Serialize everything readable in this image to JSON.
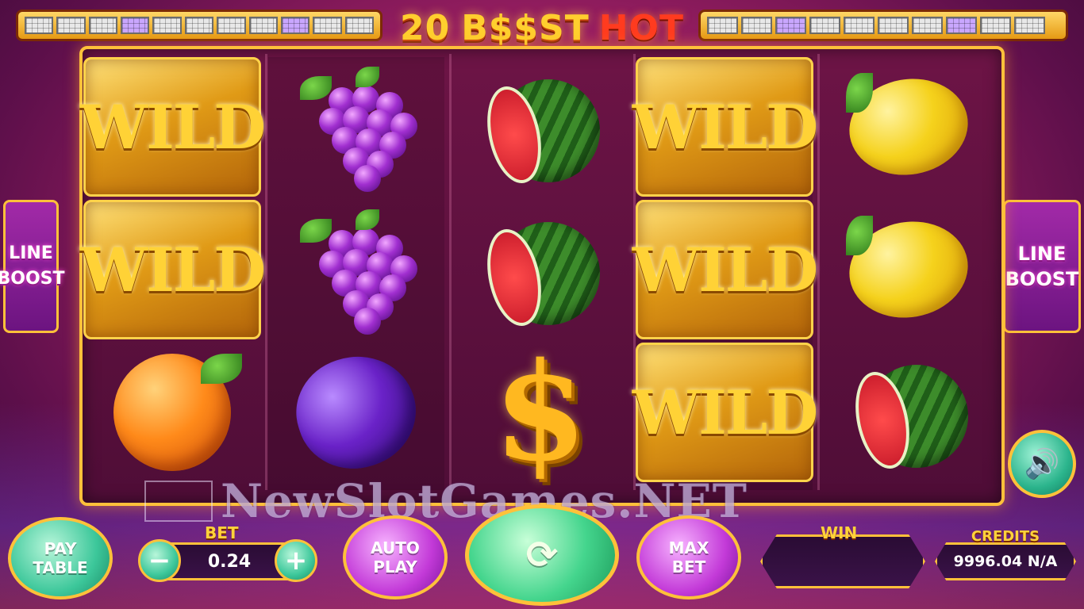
{
  "logo": {
    "number": "20",
    "word1": "B$$ST",
    "word2": "HOT"
  },
  "lines_top_left": [
    false,
    false,
    false,
    true,
    false,
    false,
    false,
    false,
    true,
    false,
    false
  ],
  "lines_top_right": [
    false,
    false,
    true,
    false,
    false,
    false,
    false,
    true,
    false,
    false
  ],
  "reels": [
    [
      "wild",
      "wild",
      "orange"
    ],
    [
      "grapes",
      "grapes",
      "plum"
    ],
    [
      "watermelon",
      "watermelon",
      "dollar"
    ],
    [
      "wild",
      "wild",
      "wild"
    ],
    [
      "lemon",
      "lemon",
      "watermelon"
    ]
  ],
  "wild_text": "WILD",
  "dollar_text": "$",
  "line_boost": {
    "line1": "LINE",
    "line2": "BOOST"
  },
  "watermark": "NewSlotGames.NET",
  "buttons": {
    "pay_table_1": "PAY",
    "pay_table_2": "TABLE",
    "auto_play_1": "AUTO",
    "auto_play_2": "PLAY",
    "max_bet_1": "MAX",
    "max_bet_2": "BET",
    "spin_icon": "⟳",
    "minus": "−",
    "plus": "+",
    "sound_icon": "🔊"
  },
  "bet": {
    "label": "BET",
    "value": "0.24"
  },
  "win": {
    "label": "WIN",
    "value": ""
  },
  "credits": {
    "label": "CREDITS",
    "value": "9996.04 N/A"
  },
  "colors": {
    "gold": "#ffc13a",
    "accent_green": "#3cc79a",
    "accent_purple": "#c33ad8"
  }
}
